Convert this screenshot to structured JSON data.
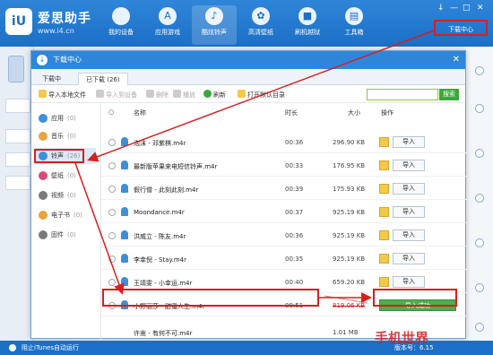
{
  "app": {
    "logo_text": "iU",
    "brand": "爱思助手",
    "url": "www.i4.cn"
  },
  "nav": [
    {
      "label": "我的设备",
      "icon": "apple-icon"
    },
    {
      "label": "应用游戏",
      "icon": "app-store-icon"
    },
    {
      "label": "酷炫铃声",
      "icon": "bell-icon"
    },
    {
      "label": "高清壁纸",
      "icon": "flower-icon"
    },
    {
      "label": "刷机越狱",
      "icon": "box-icon"
    },
    {
      "label": "工具箱",
      "icon": "toolbox-icon"
    }
  ],
  "download_center_button": "下载中心",
  "window_controls": [
    "↓",
    "—",
    "□",
    "✕"
  ],
  "dialog": {
    "title": "下载中心",
    "close": "✕",
    "tabs": [
      "下载中",
      "已下载 (26)"
    ],
    "toolbar": {
      "import_local": "导入本地文件",
      "import_device": "导入到设备",
      "delete": "删除",
      "play": "播放",
      "refresh": "刷新",
      "open_dir": "打开默认目录",
      "search_btn": "搜索"
    },
    "categories": [
      {
        "name": "应用",
        "count": "(0)",
        "color": "#3d8fd9"
      },
      {
        "name": "音乐",
        "count": "(0)",
        "color": "#e8a53a"
      },
      {
        "name": "铃声",
        "count": "(26)",
        "color": "#3d8fd9"
      },
      {
        "name": "壁纸",
        "count": "(0)",
        "color": "#d64d7a"
      },
      {
        "name": "视频",
        "count": "(0)",
        "color": "#7a7a7a"
      },
      {
        "name": "电子书",
        "count": "(0)",
        "color": "#e8a53a"
      },
      {
        "name": "固件",
        "count": "(0)",
        "color": "#7a7a7a"
      }
    ],
    "columns": {
      "name": "名称",
      "duration": "时长",
      "size": "大小",
      "action": "操作"
    },
    "rows": [
      {
        "name": "泡沫 - 邓紫棋.m4r",
        "duration": "00:36",
        "size": "296.90 KB",
        "action": "导入"
      },
      {
        "name": "最新版苹果来电短信铃声.m4r",
        "duration": "00:33",
        "size": "176.95 KB",
        "action": "导入"
      },
      {
        "name": "假行僧 - 此刻此刻.m4r",
        "duration": "00:39",
        "size": "175.93 KB",
        "action": "导入"
      },
      {
        "name": "Moondance.m4r",
        "duration": "00:37",
        "size": "925.19 KB",
        "action": "导入"
      },
      {
        "name": "洪威立 - 陈友.m4r",
        "duration": "00:36",
        "size": "925.19 KB",
        "action": "导入"
      },
      {
        "name": "李幸倪 - Stay.m4r",
        "duration": "00:35",
        "size": "925.19 KB",
        "action": "导入"
      },
      {
        "name": "王靖雯 - 小幸运.m4r",
        "duration": "00:40",
        "size": "659.20 KB",
        "action": "导入"
      },
      {
        "name": "小野丽莎 - 甜蜜人生.m4r",
        "duration": "00:51",
        "size": "819.06 KB",
        "action": "导入成功"
      }
    ],
    "partial_row": {
      "name": "许嵩 - 有何不可.m4r",
      "size": "1.01 MB"
    }
  },
  "statusbar": {
    "text": "阻止iTunes自动运行",
    "version": "版本号：6.15"
  },
  "watermark": "手机世界"
}
